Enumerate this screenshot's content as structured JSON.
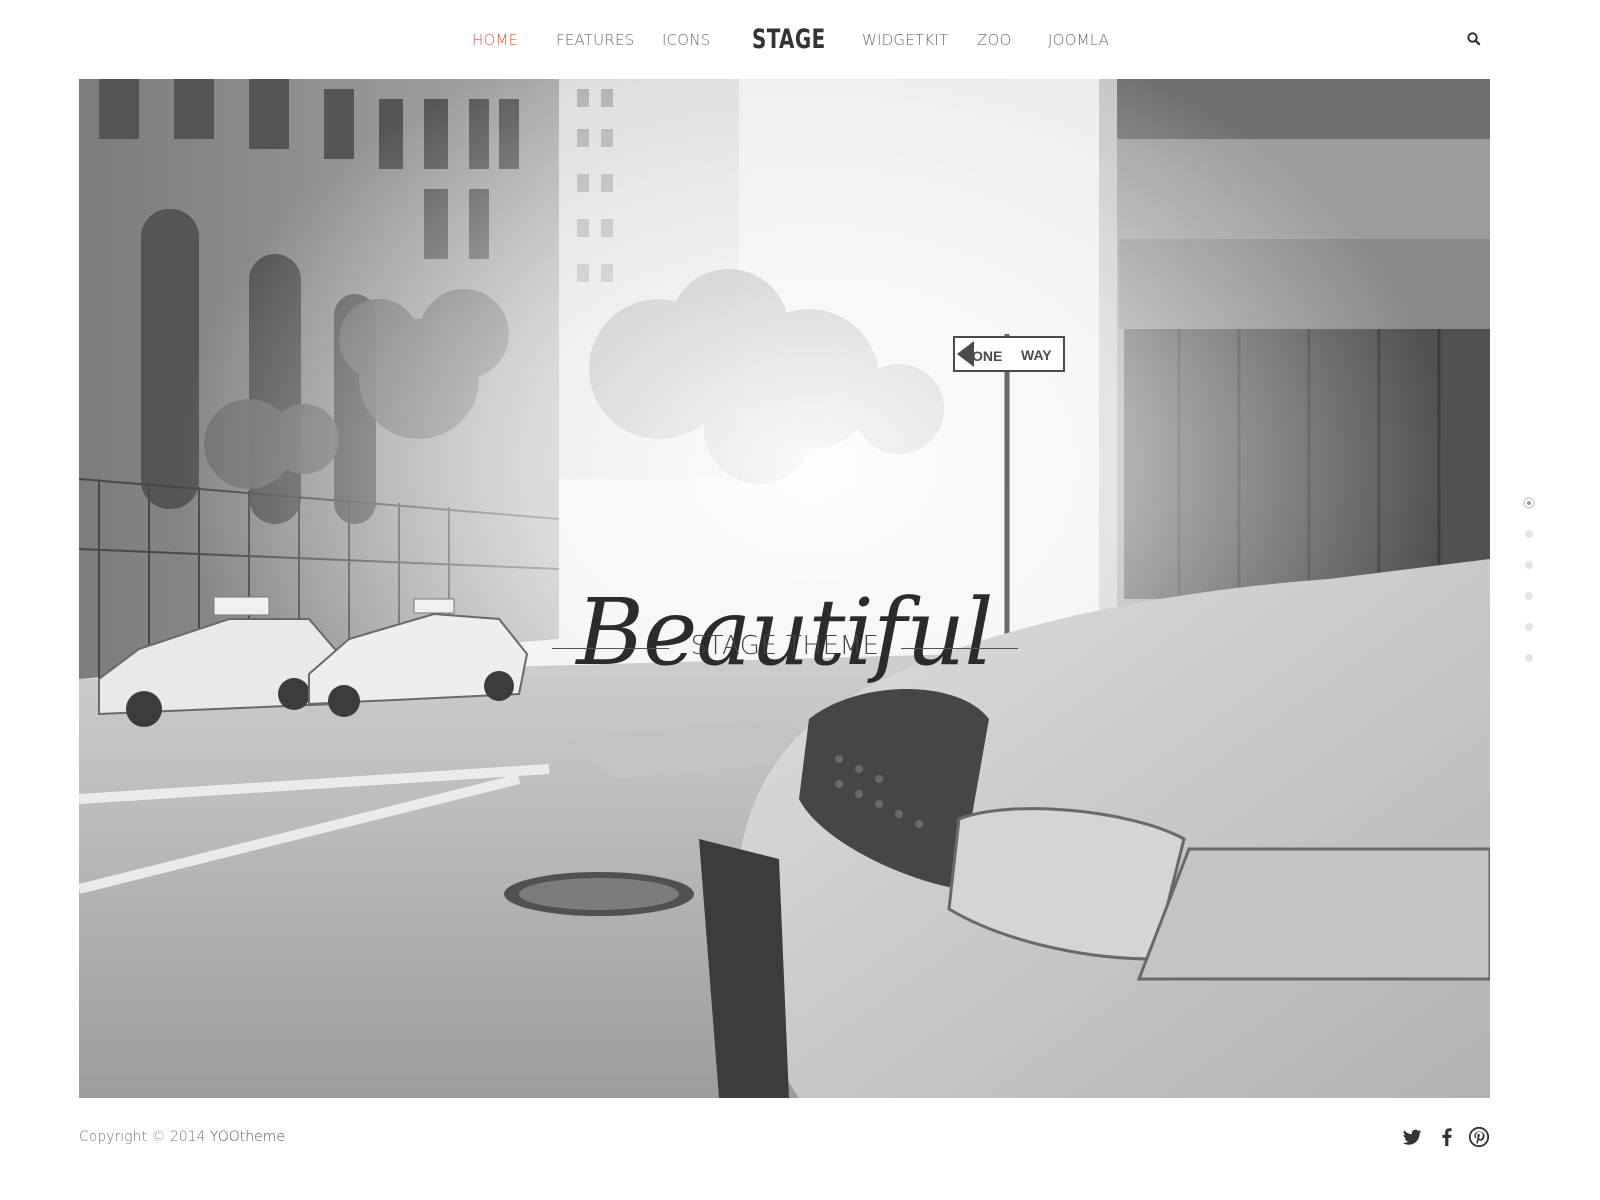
{
  "nav": {
    "left_items": [
      "HOME",
      "FEATURES",
      "ICONS"
    ],
    "logo": "STAGE",
    "right_items": [
      "WIDGETKIT",
      "ZOO",
      "JOOMLA"
    ],
    "active_item": "HOME",
    "search_icon": "search-icon"
  },
  "hero": {
    "title": "Beautiful",
    "subtitle": "STAGE THEME",
    "sign_left": "ONE",
    "sign_right": "WAY"
  },
  "slideshow": {
    "dot_count": 6,
    "active_index": 0
  },
  "footer": {
    "copyright_prefix": "Copyright © 2014 ",
    "copyright_link": "YOOtheme",
    "social_icons": [
      "twitter-icon",
      "facebook-icon",
      "pinterest-icon"
    ]
  },
  "colors": {
    "accent": "#e5533a",
    "text": "#6b6b6b",
    "logo": "#333333"
  }
}
